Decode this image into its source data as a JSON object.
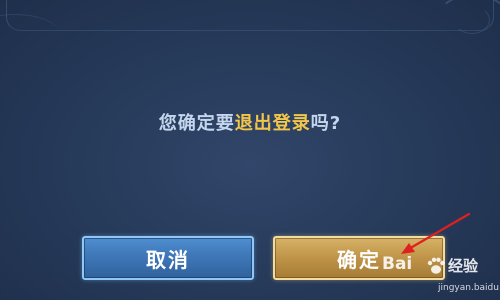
{
  "dialog": {
    "message_prefix": "您确定要",
    "message_highlight": "退出登录",
    "message_suffix": "吗?"
  },
  "buttons": {
    "cancel_label": "取消",
    "confirm_label": "确定"
  },
  "watermark": {
    "logo_text": "Bai",
    "name": "经验",
    "url": "jingyan.baidu.com"
  },
  "colors": {
    "background": "#273b5b",
    "message_text": "#c4d6ee",
    "highlight_text": "#f1c64a",
    "cancel_button": "#3f77b8",
    "confirm_button": "#bf9448",
    "annotation_arrow": "#e02020"
  }
}
